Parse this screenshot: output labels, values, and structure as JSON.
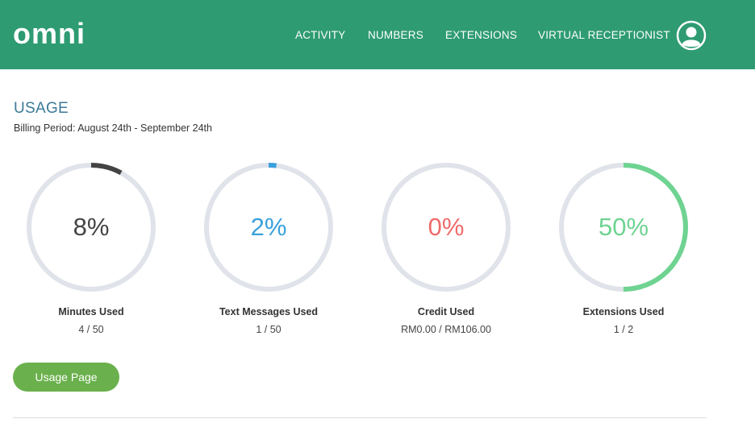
{
  "header": {
    "logo_text": "omni",
    "nav": [
      "ACTIVITY",
      "NUMBERS",
      "EXTENSIONS",
      "VIRTUAL RECEPTIONIST"
    ],
    "avatar_icon": "user-avatar-icon",
    "background_color": "#2e9b73"
  },
  "usage": {
    "title": "USAGE",
    "billing_period": "Billing Period: August 24th - September 24th",
    "track_color": "#e0e3ea",
    "gauges": [
      {
        "percent_text": "8%",
        "percent": 8,
        "label": "Minutes Used",
        "value": "4 / 50",
        "color": "#444444"
      },
      {
        "percent_text": "2%",
        "percent": 2,
        "label": "Text Messages Used",
        "value": "1 / 50",
        "color": "#3aa0dc"
      },
      {
        "percent_text": "0%",
        "percent": 0,
        "label": "Credit Used",
        "value": "RM0.00 / RM106.00",
        "color": "#f06b6b"
      },
      {
        "percent_text": "50%",
        "percent": 50,
        "label": "Extensions Used",
        "value": "1 / 2",
        "color": "#6fd391"
      }
    ],
    "button_label": "Usage Page",
    "button_color": "#6ab04c"
  }
}
